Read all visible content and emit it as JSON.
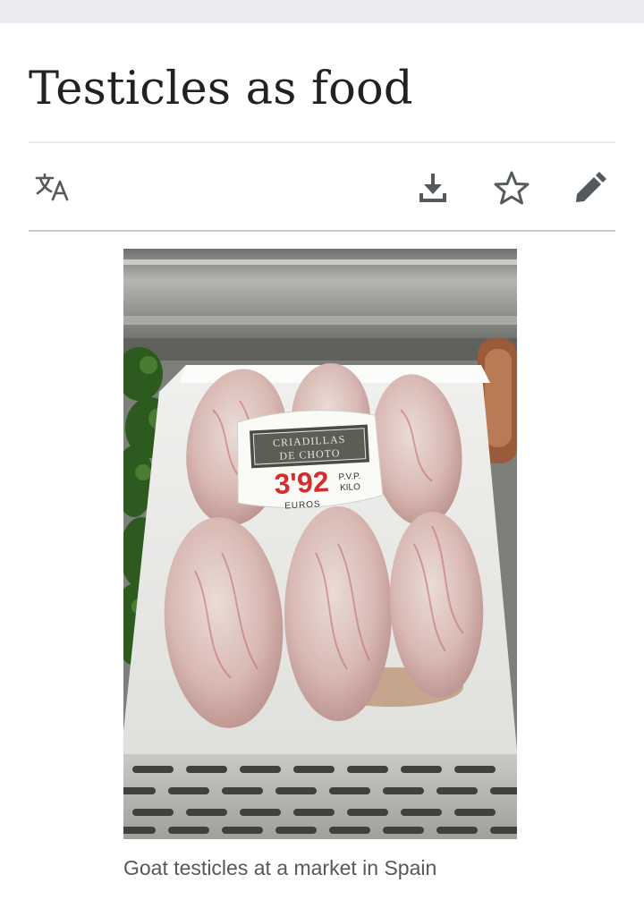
{
  "page": {
    "title": "Testicles as food"
  },
  "toolbar": {
    "items": [
      {
        "name": "language",
        "icon": "translate-icon"
      },
      {
        "name": "download",
        "icon": "download-icon"
      },
      {
        "name": "watch",
        "icon": "star-outline-icon"
      },
      {
        "name": "edit",
        "icon": "pencil-icon"
      }
    ],
    "icon_color": "#54595d"
  },
  "figure": {
    "price_sign": {
      "line1": "CRIADILLAS",
      "line2": "DE CHOTO",
      "price": "3'92",
      "unit_line1": "P.V.P.",
      "unit_line2": "KILO",
      "currency": "EUROS"
    },
    "caption": "Goat testicles at a market in Spain"
  },
  "colors": {
    "title_text": "#202122",
    "caption_text": "#54595d",
    "rule": "#eaecf0",
    "price_red": "#d32d2d"
  }
}
